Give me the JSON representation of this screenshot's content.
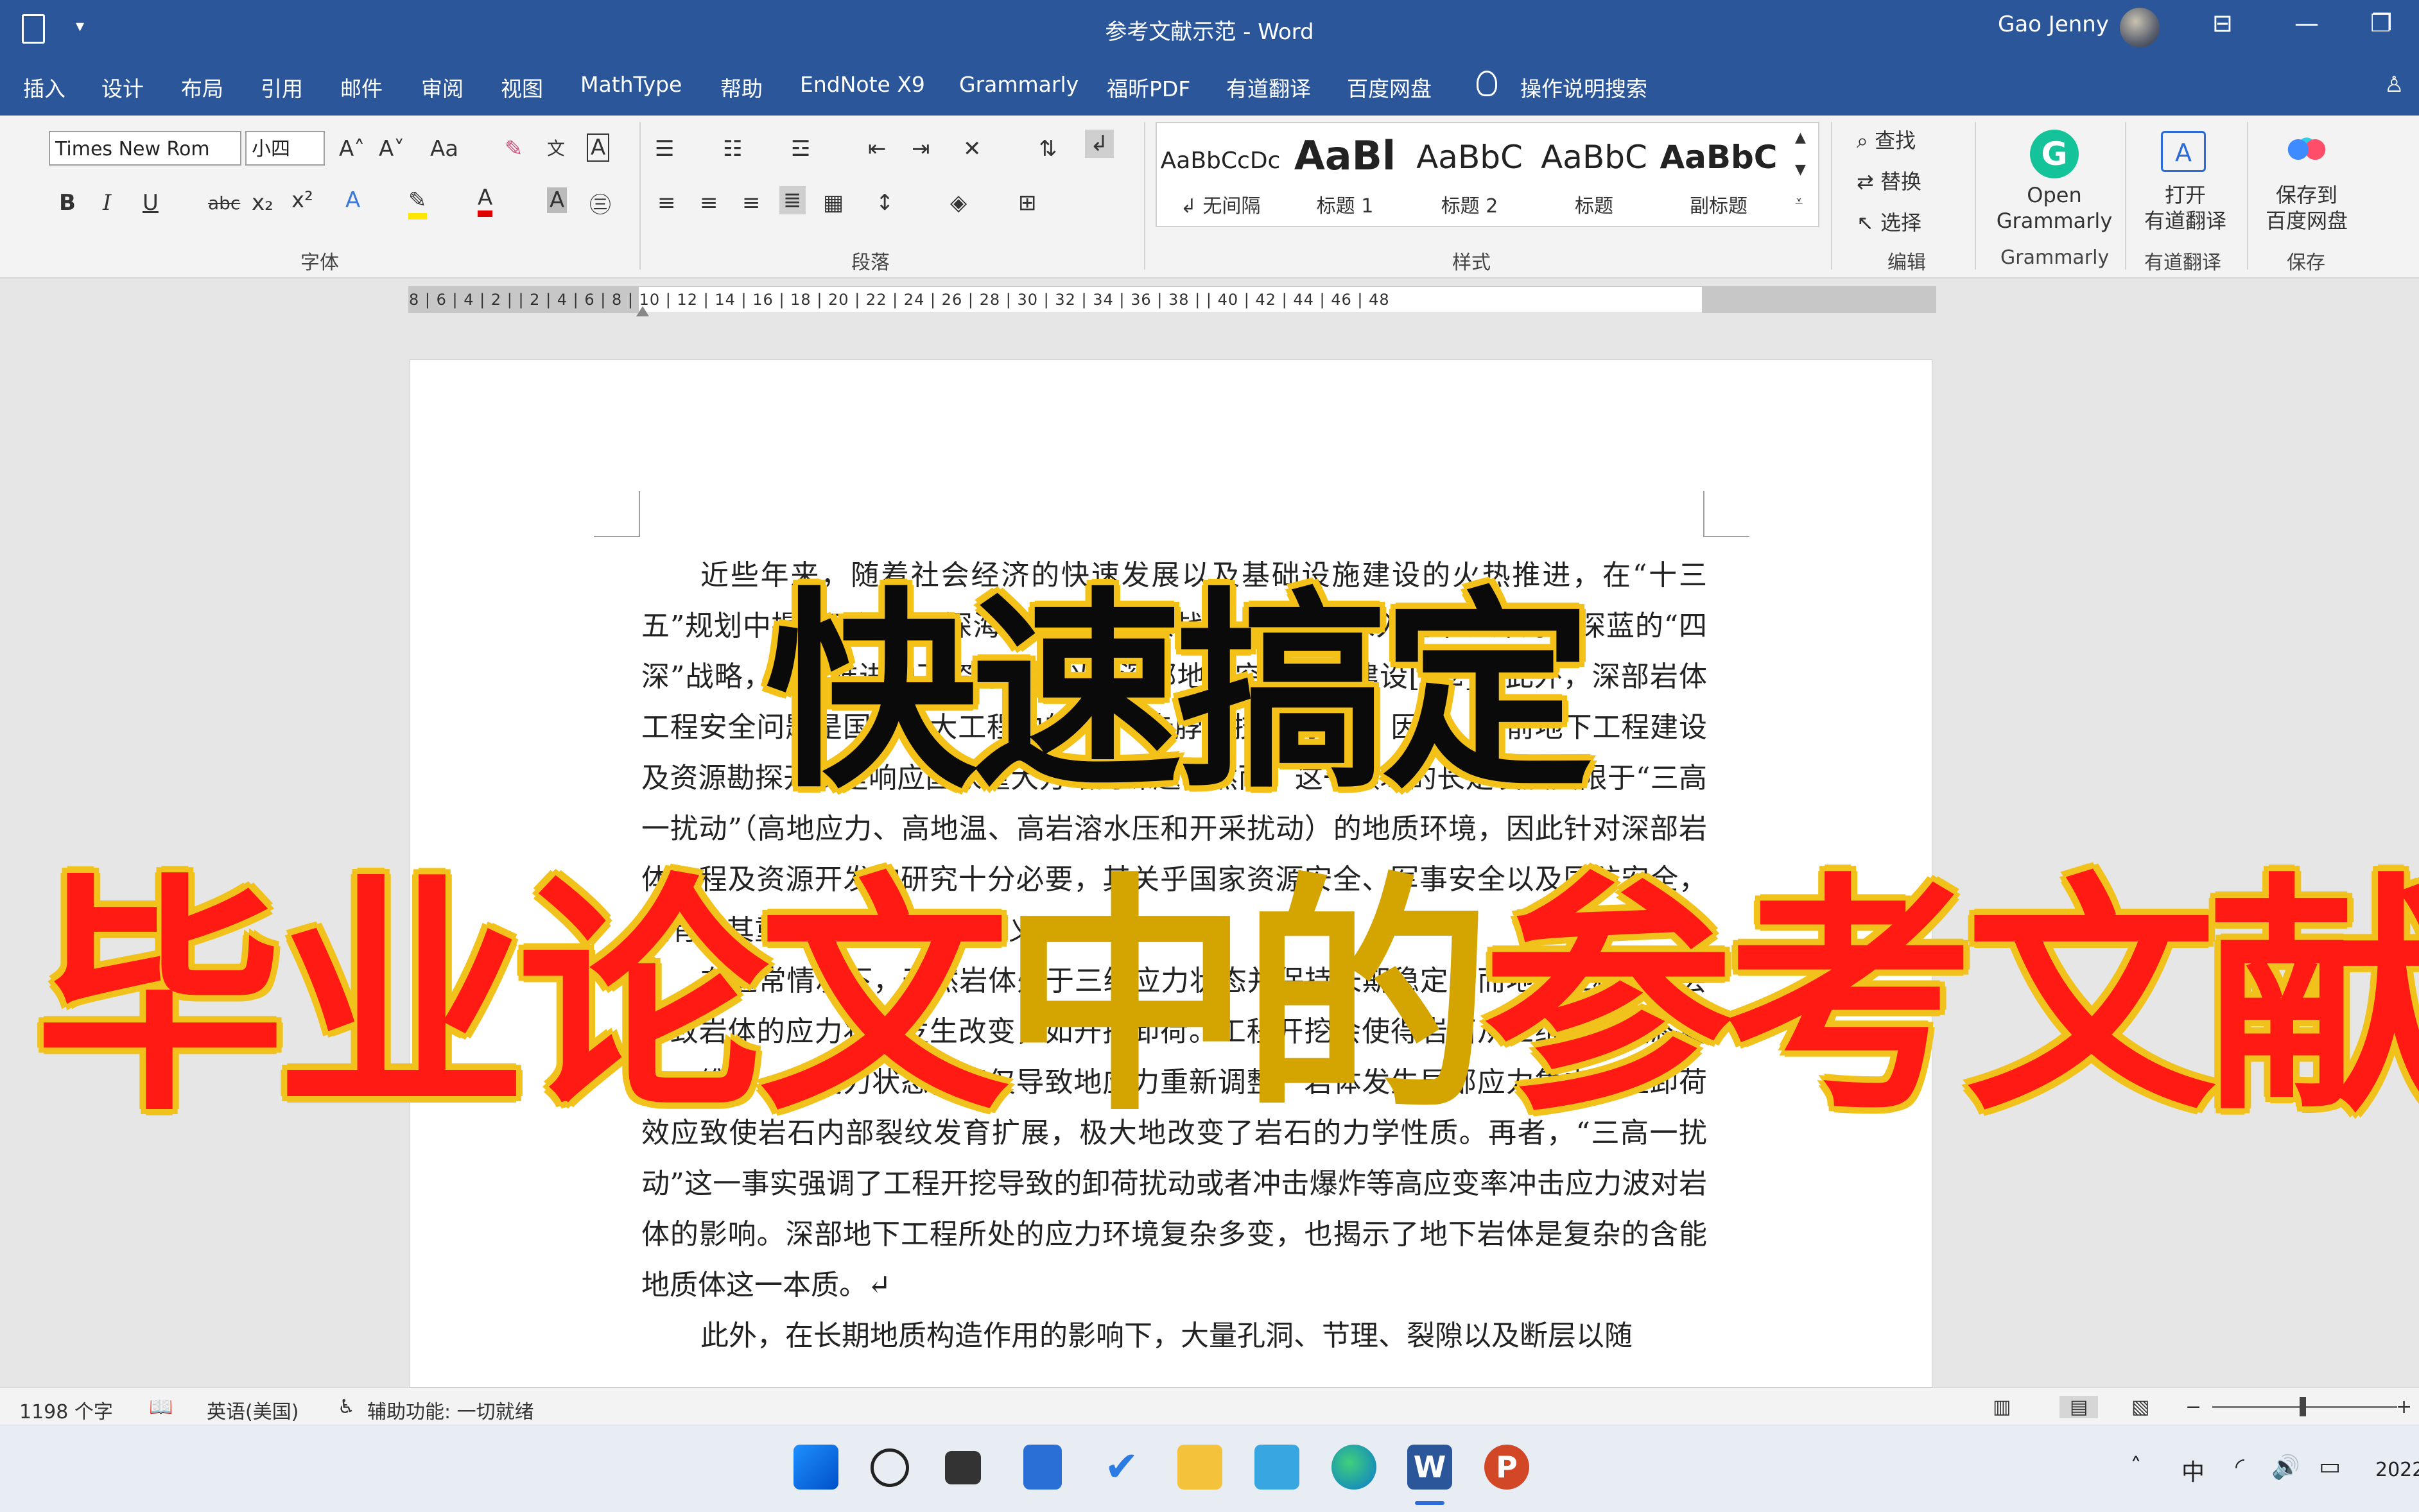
{
  "window": {
    "title": "参考文献示范  -  Word",
    "user": "Gao Jenny",
    "qat_symbol": "▾"
  },
  "menu": {
    "tabs": [
      "插入",
      "设计",
      "布局",
      "引用",
      "邮件",
      "审阅",
      "视图",
      "MathType",
      "帮助",
      "EndNote X9",
      "Grammarly",
      "福昕PDF",
      "有道翻译",
      "百度网盘"
    ],
    "search": "操作说明搜索"
  },
  "ribbon": {
    "font_name": "Times New Rom",
    "font_size": "小四",
    "groups": {
      "font": "字体",
      "paragraph": "段落",
      "styles": "样式",
      "editing": "编辑",
      "grammarly": "Grammarly",
      "youdao": "有道翻译",
      "save": "保存"
    },
    "styles": [
      {
        "sample": "AaBbCcDc",
        "name": "↲ 无间隔"
      },
      {
        "sample": "AaBl",
        "name": "标题 1"
      },
      {
        "sample": "AaBbC",
        "name": "标题 2"
      },
      {
        "sample": "AaBbC",
        "name": "标题"
      },
      {
        "sample": "AaBbC",
        "name": "副标题"
      }
    ],
    "editing": {
      "find": "查找",
      "replace": "替换",
      "select": "选择"
    },
    "open_grammarly": "Open\nGrammarly",
    "open_youdao": "打开\n有道翻译",
    "save_baidu": "保存到\n百度网盘"
  },
  "ruler": {
    "labels": "8 | 6 | 4 | 2 |     | 2 | 4 | 6 | 8 | 10 | 12 | 14 | 16 | 18 | 20 | 22 | 24 | 26 | 28 | 30 | 32 | 34 | 36 | 38 |    | 40 | 42 | 44 | 46 | 48"
  },
  "document": {
    "paragraphs": [
      "近些年来，随着社会经济的快速发展以及基础设施建设的火热推进，在“十三五”规划中提出了深地、深海、深空等国家战略，提出了深入地下、深海、深蓝的“四深”战略，深入推进地下资源开发以及深部地下空间工程建设[1,2]。此外，深部岩体工程安全问题是国家重大工程中的一个“卡脖子技术问题”，因此，当前地下工程建设及资源勘探开发是响应国家重大方略的课题，然而，这一领域的长足发展受限于“三高一扰动”（高地应力、高地温、高岩溶水压和开采扰动）的地质环境，因此针对深部岩体工程及资源开发的研究十分必要，其关乎国家资源安全、军事安全以及国防安全，具有极其重要的价值和战略意义。",
      "在通常情况下，天然岩体处于三维应力状态并保持长期稳定。而地下工程建设会导致岩体的应力状态发生改变，如开挖卸荷。工程开挖会使得岩石从三维受力状态变为二维或一维受力状态，不仅导致地应力重新调整，岩体发生局部应力集中，且卸荷效应致使岩石内部裂纹发育扩展，极大地改变了岩石的力学性质。再者，“三高一扰动”这一事实强调了工程开挖导致的卸荷扰动或者冲击爆炸等高应变率冲击应力波对岩体的影响。深部地下工程所处的应力环境复杂多变，也揭示了地下岩体是复杂的含能地质体这一本质。↵",
      "此外，在长期地质构造作用的影响下，大量孔洞、节理、裂隙以及断层以随"
    ]
  },
  "overlay": {
    "line1": "快速搞定",
    "line2_part1": "毕业论文",
    "line2_part2": "中的",
    "line2_part3": "参考文献"
  },
  "status": {
    "word_count": "1198 个字",
    "language": "英语(美国)",
    "accessibility": "辅助功能: 一切就绪"
  },
  "taskbar": {
    "ime": "中",
    "date_partial": "2022"
  }
}
